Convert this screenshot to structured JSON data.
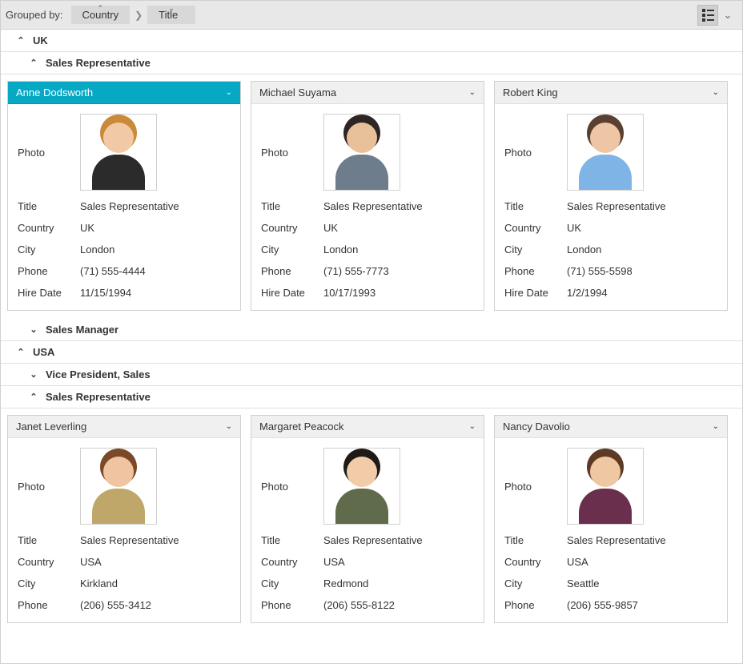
{
  "toolbar": {
    "grouped_by_label": "Grouped by:",
    "crumb1": "Country",
    "crumb2": "Title"
  },
  "groups": {
    "uk": {
      "label": "UK"
    },
    "uk_sales_rep": {
      "label": "Sales Representative"
    },
    "uk_sales_mgr": {
      "label": "Sales Manager"
    },
    "usa": {
      "label": "USA"
    },
    "usa_vp": {
      "label": "Vice President, Sales"
    },
    "usa_sales_rep": {
      "label": "Sales Representative"
    }
  },
  "field_labels": {
    "photo": "Photo",
    "title": "Title",
    "country": "Country",
    "city": "City",
    "phone": "Phone",
    "hire_date": "Hire Date"
  },
  "cards": {
    "anne": {
      "name": "Anne Dodsworth",
      "title": "Sales Representative",
      "country": "UK",
      "city": "London",
      "phone": "(71) 555-4444",
      "hire_date": "11/15/1994",
      "skin": "#f2c9a7",
      "clothes": "#2b2b2b",
      "hair": "#c98a3a"
    },
    "michael": {
      "name": "Michael Suyama",
      "title": "Sales Representative",
      "country": "UK",
      "city": "London",
      "phone": "(71) 555-7773",
      "hire_date": "10/17/1993",
      "skin": "#e8c19a",
      "clothes": "#6e7d8c",
      "hair": "#2e2622"
    },
    "robert": {
      "name": "Robert King",
      "title": "Sales Representative",
      "country": "UK",
      "city": "London",
      "phone": "(71) 555-5598",
      "hire_date": "1/2/1994",
      "skin": "#efc6a5",
      "clothes": "#7fb4e6",
      "hair": "#5a4030"
    },
    "janet": {
      "name": "Janet Leverling",
      "title": "Sales Representative",
      "country": "USA",
      "city": "Kirkland",
      "phone": "(206) 555-3412",
      "skin": "#f0c4a0",
      "clothes": "#bfa76a",
      "hair": "#7a4a28"
    },
    "margaret": {
      "name": "Margaret Peacock",
      "title": "Sales Representative",
      "country": "USA",
      "city": "Redmond",
      "phone": "(206) 555-8122",
      "skin": "#f2cba8",
      "clothes": "#5f6b4a",
      "hair": "#1e1a18"
    },
    "nancy": {
      "name": "Nancy Davolio",
      "title": "Sales Representative",
      "country": "USA",
      "city": "Seattle",
      "phone": "(206) 555-9857",
      "skin": "#f0c7a3",
      "clothes": "#6a2f4c",
      "hair": "#5c3a24"
    }
  }
}
